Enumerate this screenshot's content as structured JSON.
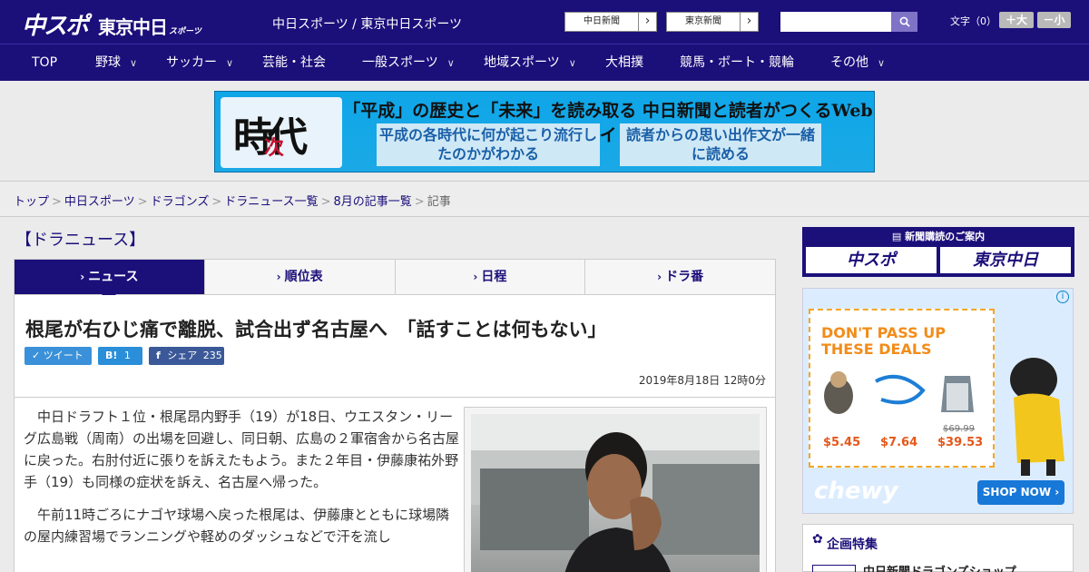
{
  "header": {
    "logo_chuspo": "中スポ",
    "logo_tokyo": "東京中日",
    "logo_tokyo_sub": "スポーツ",
    "site_title": "中日スポーツ / 東京中日スポーツ",
    "paper_links": [
      "中日新聞",
      "東京新聞"
    ],
    "search_placeholder": "",
    "fontsize_label": "文字（0）",
    "font_larger": "＋大",
    "font_smaller": "－小"
  },
  "nav": {
    "items": [
      {
        "label": "TOP",
        "has_dropdown": false
      },
      {
        "label": "野球",
        "has_dropdown": true
      },
      {
        "label": "サッカー",
        "has_dropdown": true
      },
      {
        "label": "芸能・社会",
        "has_dropdown": false
      },
      {
        "label": "一般スポーツ",
        "has_dropdown": true
      },
      {
        "label": "地域スポーツ",
        "has_dropdown": true
      },
      {
        "label": "大相撲",
        "has_dropdown": false
      },
      {
        "label": "競馬・ボート・競輪",
        "has_dropdown": false
      },
      {
        "label": "その他",
        "has_dropdown": true
      }
    ]
  },
  "banner": {
    "logo_main": "時代",
    "logo_sub": "次",
    "headline": "「平成」の歴史と「未来」を読み取る 中日新聞と読者がつくるWebサイト",
    "box_left": "平成の各時代に何が起こり流行したのかがわかる",
    "box_right": "読者からの思い出作文が一緒に読める"
  },
  "breadcrumb": {
    "links": [
      "トップ",
      "中日スポーツ",
      "ドラゴンズ",
      "ドラニュース一覧",
      "8月の記事一覧"
    ],
    "current": "記事"
  },
  "section_title": "【ドラニュース】",
  "tabs": [
    {
      "label": "ニュース",
      "active": true
    },
    {
      "label": "順位表",
      "active": false
    },
    {
      "label": "日程",
      "active": false
    },
    {
      "label": "ドラ番",
      "active": false
    }
  ],
  "article": {
    "headline": "根尾が右ひじ痛で離脱、試合出ず名古屋へ　「話すことは何もない」",
    "tweet_label": "ツイート",
    "hatena_label": "B!",
    "hatena_count": "1",
    "share_label": "シェア",
    "share_count": "235",
    "date": "2019年8月18日 12時0分",
    "paragraphs": [
      "中日ドラフト１位・根尾昂内野手（19）が18日、ウエスタン・リーグ広島戦（周南）の出場を回避し、同日朝、広島の２軍宿舎から名古屋に戻った。右肘付近に張りを訴えたもよう。また２年目・伊藤康祐外野手（19）も同様の症状を訴え、名古屋へ帰った。",
      "午前11時ごろにナゴヤ球場へ戻った根尾は、伊藤康とともに球場隣の屋内練習場でランニングや軽めのダッシュなどで汗を流し"
    ]
  },
  "sidebar": {
    "subscription_head": "新聞購読のご案内",
    "subscription_buttons": [
      "中スポ",
      "東京中日"
    ],
    "ad": {
      "headline": "DON'T PASS UP THESE DEALS",
      "prices": [
        "$5.45",
        "$7.64",
        "$39.53"
      ],
      "strike_price": "$69.99",
      "brand": "chewy",
      "cta": "SHOP NOW ›"
    },
    "feature_title": "企画特集",
    "feature_item": "中日新聞ドラゴンズショップ"
  },
  "colors": {
    "brand": "#1b0f7a",
    "twitter": "#3a91d9",
    "hatena": "#2a8fd8",
    "facebook": "#3b5998"
  }
}
